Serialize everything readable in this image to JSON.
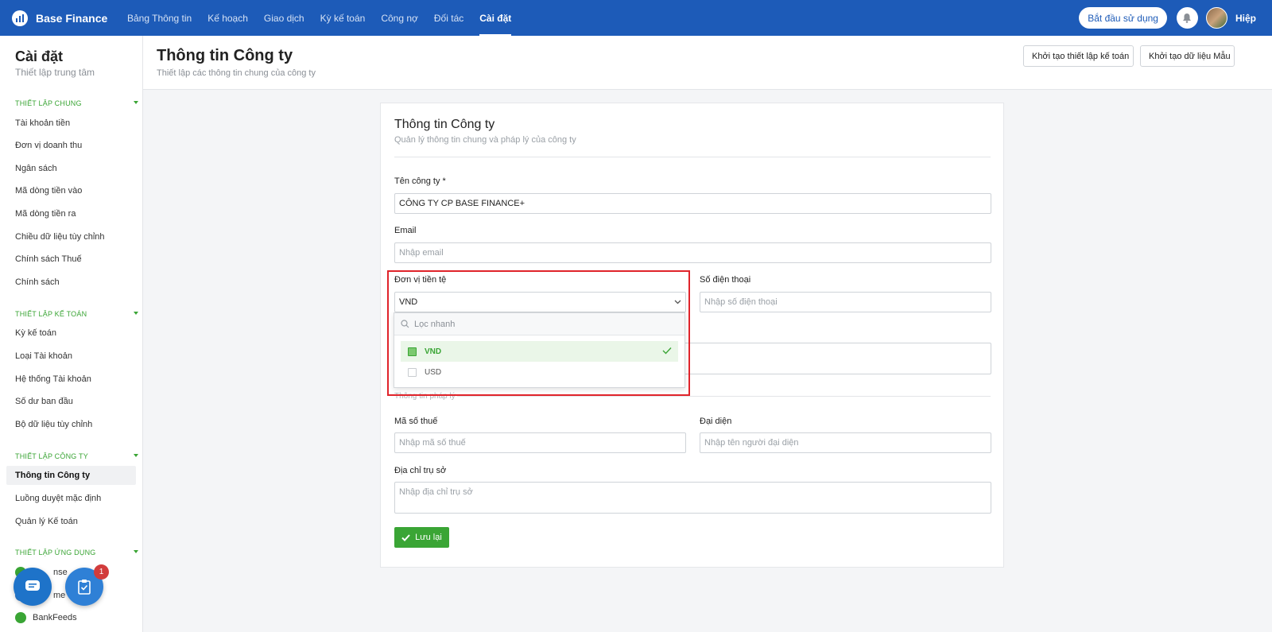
{
  "topbar": {
    "brand": "Base Finance",
    "nav": [
      "Bảng Thông tin",
      "Kế hoạch",
      "Giao dịch",
      "Kỳ kế toán",
      "Công nợ",
      "Đối tác",
      "Cài đặt"
    ],
    "active_nav": "Cài đặt",
    "start_button": "Bắt đầu sử dụng",
    "user_name": "Hiệp"
  },
  "sidebar": {
    "title": "Cài đặt",
    "subtitle": "Thiết lập trung tâm",
    "sections": {
      "general": "THIẾT LẬP CHUNG",
      "accounting": "THIẾT LẬP KẾ TOÁN",
      "company": "THIẾT LẬP CÔNG TY",
      "apps": "THIẾT LẬP ỨNG DỤNG"
    },
    "general_items": [
      "Tài khoản tiền",
      "Đơn vị doanh thu",
      "Ngân sách",
      "Mã dòng tiền vào",
      "Mã dòng tiền ra",
      "Chiều dữ liệu tùy chỉnh",
      "Chính sách Thuế",
      "Chính sách"
    ],
    "accounting_items": [
      "Kỳ kế toán",
      "Loại Tài khoản",
      "Hệ thống Tài khoản",
      "Số dư ban đầu",
      "Bộ dữ liệu tùy chỉnh"
    ],
    "company_items": [
      "Thông tin Công ty",
      "Luồng duyệt mặc định",
      "Quản lý Kế toán"
    ],
    "app_items": [
      "nse",
      "me",
      "BankFeeds"
    ],
    "active_item": "Thông tin Công ty"
  },
  "floating": {
    "task_badge": "1"
  },
  "header": {
    "title": "Thông tin Công ty",
    "subtitle": "Thiết lập các thông tin chung của công ty",
    "btn_init_accounting": "Khởi tạo thiết lập kế toán",
    "btn_init_sample": "Khởi tạo dữ liệu Mẫu"
  },
  "card": {
    "title": "Thông tin Công ty",
    "subtitle": "Quản lý thông tin chung và pháp lý của công ty",
    "company_name_label": "Tên công ty *",
    "company_name_value": "CÔNG TY CP BASE FINANCE+",
    "email_label": "Email",
    "email_placeholder": "Nhập email",
    "currency_label": "Đơn vị tiền tệ",
    "currency_value": "VND",
    "phone_label": "Số điện thoại",
    "phone_placeholder": "Nhập số điện thoại",
    "legal_section": "Thông tin pháp lý",
    "tax_label": "Mã số thuế",
    "tax_placeholder": "Nhập mã số thuế",
    "rep_label": "Đại diện",
    "rep_placeholder": "Nhập tên người đại diện",
    "address_label": "Địa chỉ trụ sở",
    "address_placeholder": "Nhập địa chỉ trụ sở",
    "save_button": "Lưu lại"
  },
  "dropdown": {
    "search_placeholder": "Lọc nhanh",
    "options": [
      "VND",
      "USD"
    ],
    "selected": "VND"
  },
  "colors": {
    "primary": "#1d5bb8",
    "accent_green": "#3aa535",
    "highlight_red": "#e0242b"
  }
}
